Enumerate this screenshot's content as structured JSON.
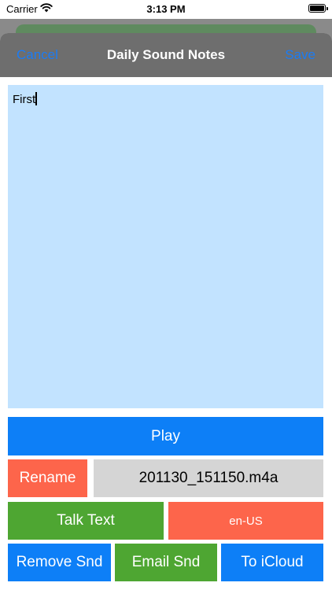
{
  "status_bar": {
    "carrier": "Carrier",
    "time": "3:13 PM",
    "wifi_icon": "wifi-icon",
    "battery_icon": "battery-icon"
  },
  "navbar": {
    "cancel_label": "Cancel",
    "title": "Daily Sound Notes",
    "save_label": "Save"
  },
  "note": {
    "text": "First"
  },
  "buttons": {
    "play": "Play",
    "rename": "Rename",
    "filename": "201130_151150.m4a",
    "talk_text": "Talk Text",
    "language": "en-US",
    "remove_sound": "Remove Snd",
    "email_sound": "Email Snd",
    "to_icloud": "To iCloud"
  },
  "colors": {
    "accent_blue": "#0d7ff7",
    "orange": "#fd654b",
    "green": "#4ea632",
    "note_background": "#c2e3ff",
    "filename_background": "#d5d5d5"
  }
}
